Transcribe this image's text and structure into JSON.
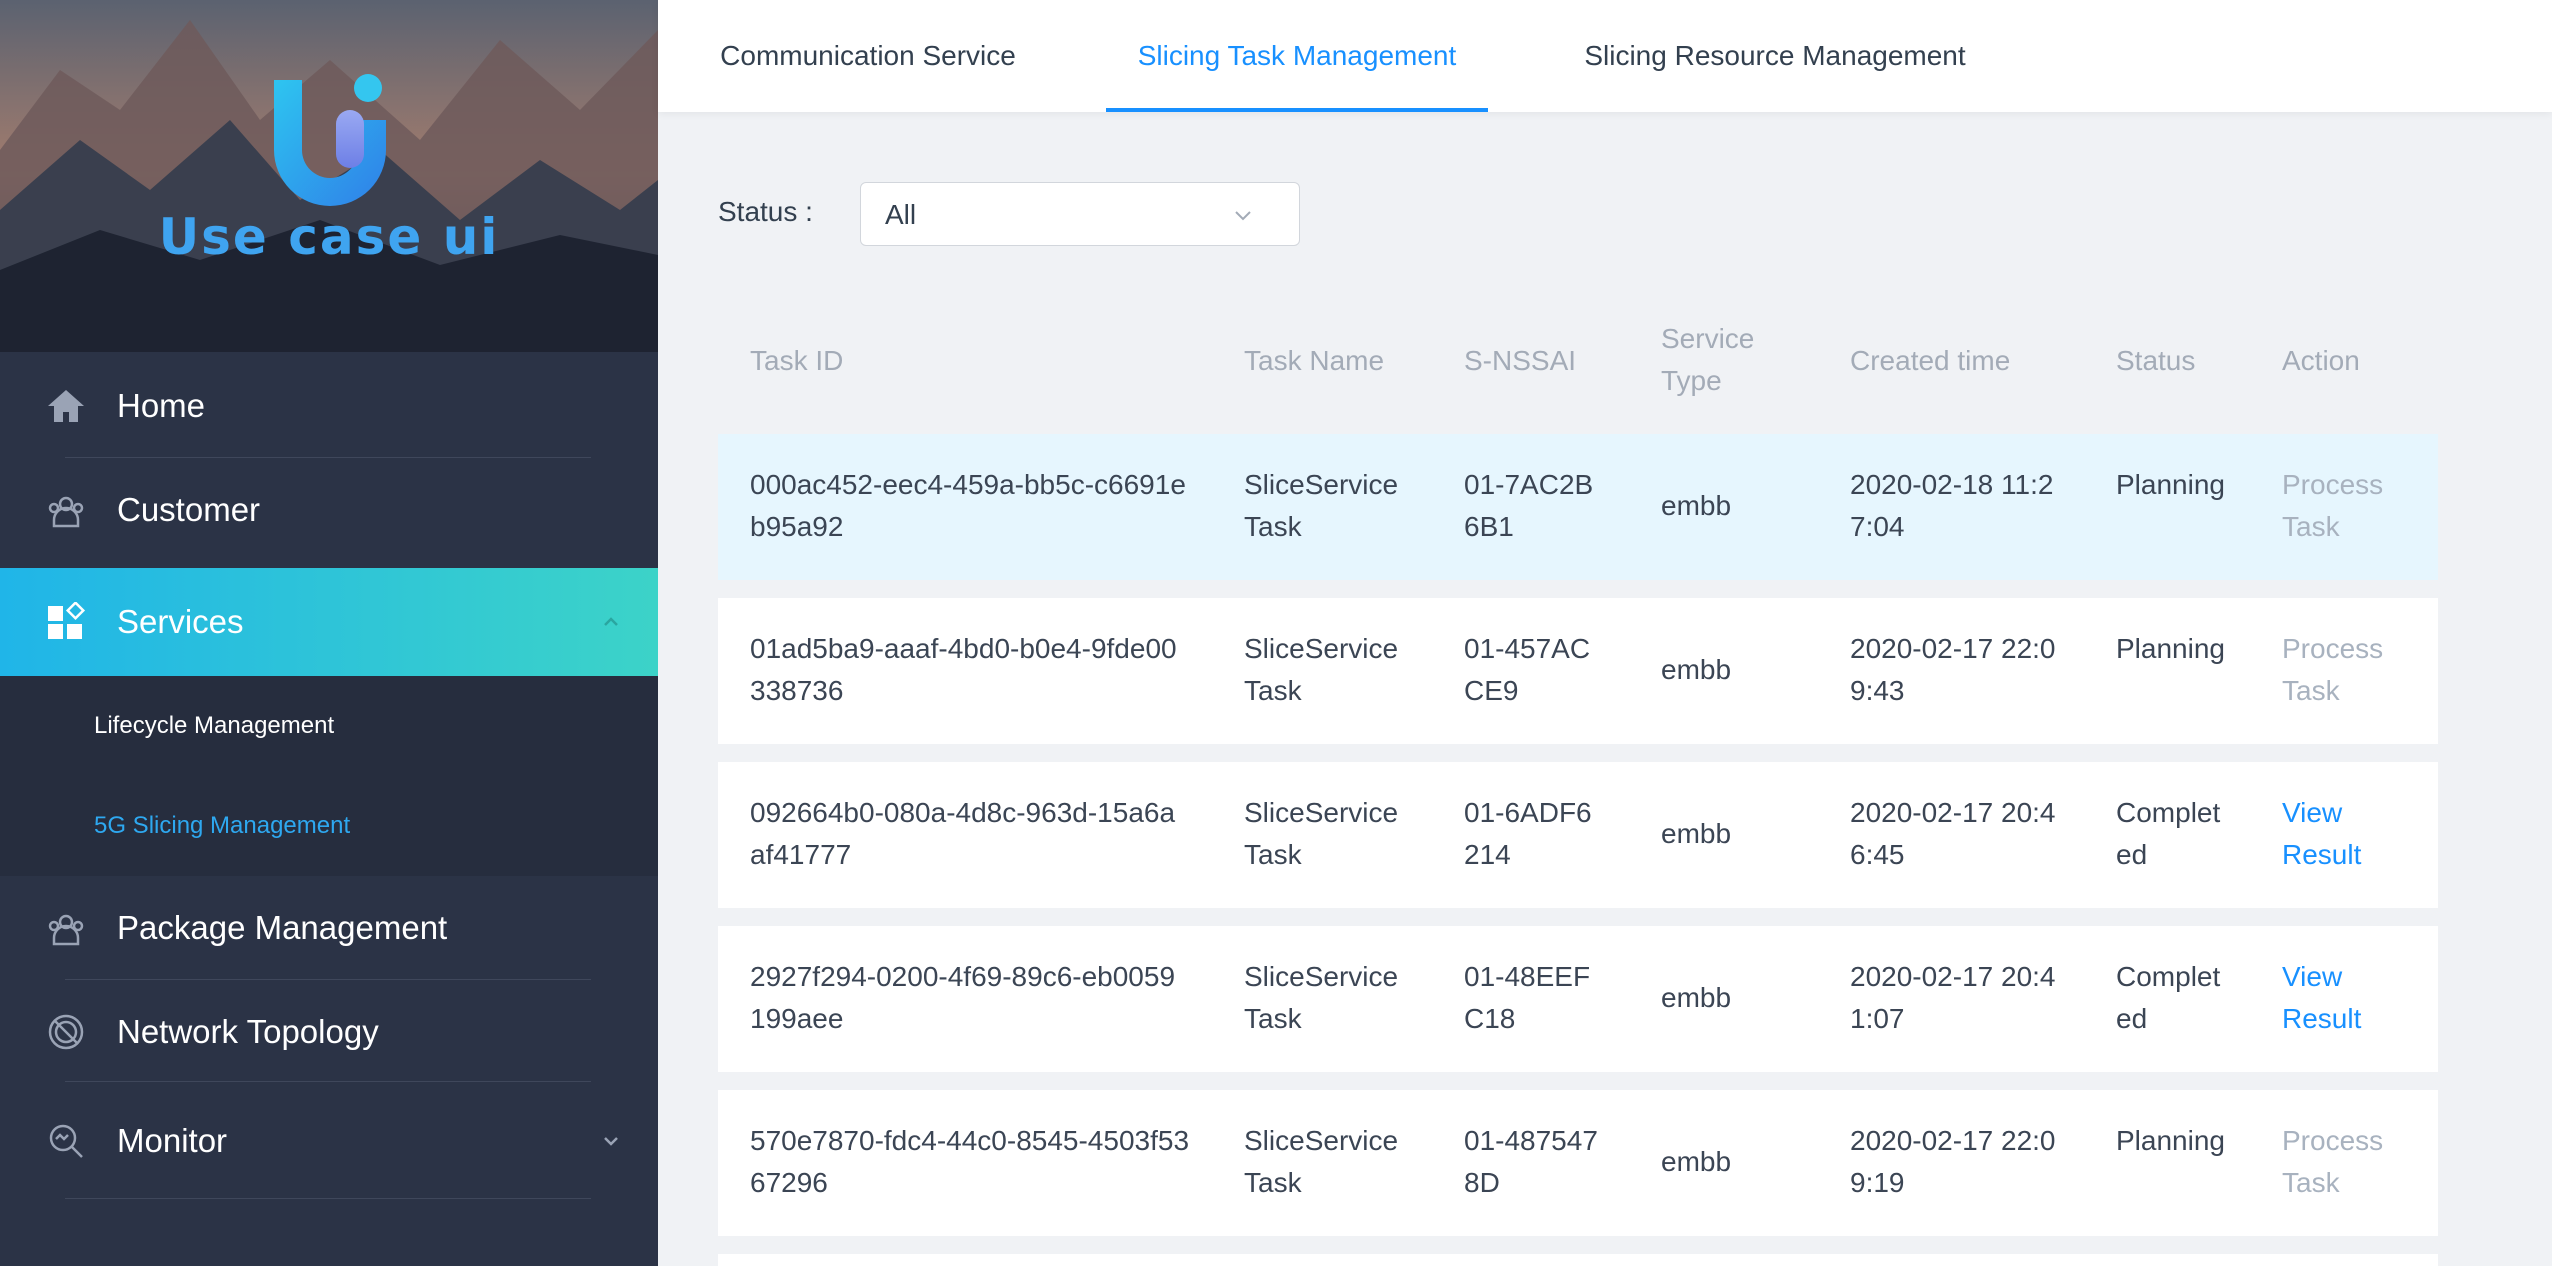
{
  "brand": {
    "name": "Use case ui"
  },
  "sidebar": {
    "items": [
      {
        "label": "Home",
        "icon": "home-icon"
      },
      {
        "label": "Customer",
        "icon": "customer-icon"
      },
      {
        "label": "Services",
        "icon": "services-icon",
        "active": true,
        "expanded": true
      },
      {
        "label": "Package Management",
        "icon": "package-icon"
      },
      {
        "label": "Network Topology",
        "icon": "network-topology-icon"
      },
      {
        "label": "Monitor",
        "icon": "monitor-icon"
      }
    ],
    "submenu": [
      {
        "label": "Lifecycle Management"
      },
      {
        "label": "5G Slicing Management",
        "active": true
      }
    ]
  },
  "tabs": [
    {
      "label": "Communication Service"
    },
    {
      "label": "Slicing Task Management",
      "active": true
    },
    {
      "label": "Slicing Resource Management"
    }
  ],
  "filter": {
    "label": "Status :",
    "value": "All"
  },
  "table": {
    "headers": [
      "Task ID",
      "Task Name",
      "S-NSSAI",
      "Service Type",
      "Created time",
      "Status",
      "Action"
    ],
    "rows": [
      {
        "task_id": "000ac452-eec4-459a-bb5c-c6691eb95a92",
        "task_name": "SliceService Task",
        "snssai": "01-7AC2B6B1",
        "service_type": "embb",
        "created": "2020-02-18 11:27:04",
        "status": "Planning",
        "action": "Process Task"
      },
      {
        "task_id": "01ad5ba9-aaaf-4bd0-b0e4-9fde00338736",
        "task_name": "SliceService Task",
        "snssai": "01-457ACCE9",
        "service_type": "embb",
        "created": "2020-02-17 22:09:43",
        "status": "Planning",
        "action": "Process Task"
      },
      {
        "task_id": "092664b0-080a-4d8c-963d-15a6aaf41777",
        "task_name": "SliceService Task",
        "snssai": "01-6ADF6214",
        "service_type": "embb",
        "created": "2020-02-17 20:46:45",
        "status": "Completed",
        "action": "View Result"
      },
      {
        "task_id": "2927f294-0200-4f69-89c6-eb0059199aee",
        "task_name": "SliceService Task",
        "snssai": "01-48EEFC18",
        "service_type": "embb",
        "created": "2020-02-17 20:41:07",
        "status": "Completed",
        "action": "View Result"
      },
      {
        "task_id": "570e7870-fdc4-44c0-8545-4503f5367296",
        "task_name": "SliceService Task",
        "snssai": "01-4875478D",
        "service_type": "embb",
        "created": "2020-02-17 22:09:19",
        "status": "Planning",
        "action": "Process Task"
      }
    ]
  },
  "colors": {
    "accent": "#1890ff",
    "sidebar_bg": "#2b3346",
    "active_gradient_start": "#20b5e8",
    "active_gradient_end": "#3cd3c8",
    "row_highlight": "#e6f6fe"
  }
}
